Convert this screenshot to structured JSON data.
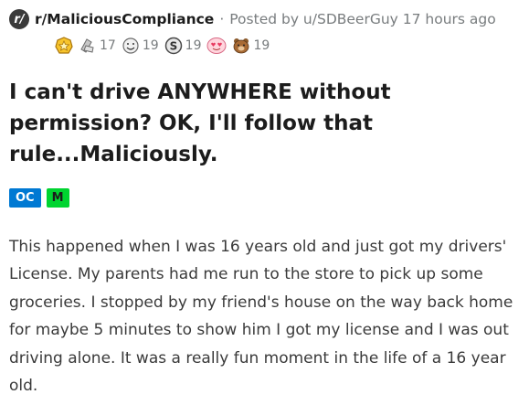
{
  "post": {
    "subreddit": "r/MaliciousCompliance",
    "subreddit_icon_text": "r/",
    "separator": "·",
    "posted_by": "Posted by u/SDBeerGuy 17 hours ago",
    "title": "I can't drive ANYWHERE without permission? OK, I'll follow that rule...Maliciously.",
    "flairs": [
      "OC",
      "M"
    ],
    "body": "This happened when I was 16 years old and just got my drivers' License. My parents had me run to the store to pick up some groceries. I stopped by my friend's house on the way back home for maybe 5 minutes to show him I got my license and I was out driving alone. It was a really fun moment in the life of a 16 year old."
  },
  "awards": [
    {
      "icon": "gold-star-award-icon",
      "count": ""
    },
    {
      "icon": "silver-award-icon",
      "count": "17"
    },
    {
      "icon": "smile-award-icon",
      "count": "19"
    },
    {
      "icon": "s-coin-award-icon",
      "count": "19"
    },
    {
      "icon": "heart-eyes-award-icon",
      "count": ""
    },
    {
      "icon": "bear-award-icon",
      "count": "19"
    }
  ],
  "colors": {
    "flair_oc": "#0079d3",
    "flair_m": "#00d430",
    "meta_gray": "#787c7e",
    "title": "#1c1c1c",
    "body": "#3a3a3a"
  }
}
